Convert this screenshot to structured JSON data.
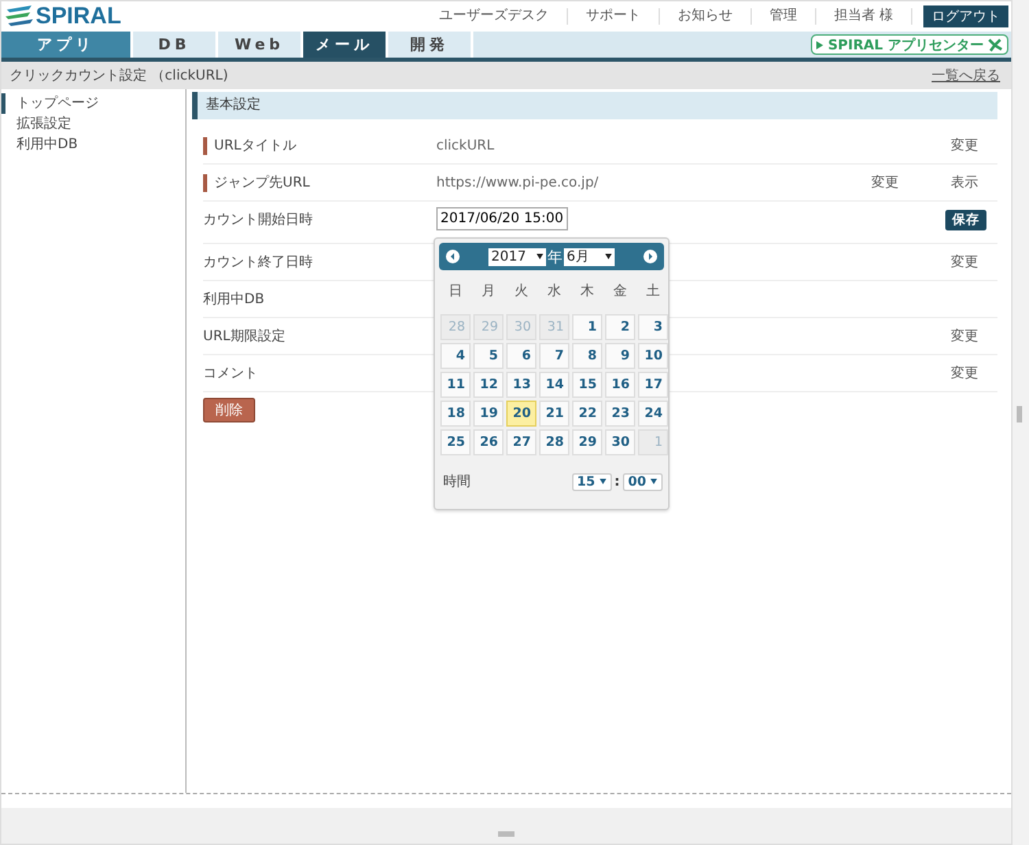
{
  "header": {
    "logo": "SPIRAL",
    "links": [
      "ユーザーズデスク",
      "サポート",
      "お知らせ",
      "管理",
      "担当者 様"
    ],
    "logout": "ログアウト"
  },
  "tabs": [
    {
      "label": "アプリ",
      "selected": false,
      "active": true
    },
    {
      "label": "DB",
      "selected": false,
      "active": false
    },
    {
      "label": "Web",
      "selected": false,
      "active": false
    },
    {
      "label": "メール",
      "selected": true,
      "active": false
    },
    {
      "label": "開発",
      "selected": false,
      "active": false
    }
  ],
  "app_center": "SPIRAL アプリセンター",
  "breadcrumb": {
    "title": "クリックカウント設定 （clickURL)",
    "back_link": "一覧へ戻る"
  },
  "sidebar": {
    "items": [
      {
        "label": "トップページ",
        "selected": true
      },
      {
        "label": "拡張設定",
        "selected": false
      },
      {
        "label": "利用中DB",
        "selected": false
      }
    ]
  },
  "section_title": "基本設定",
  "rows": [
    {
      "kind": "text",
      "label": "URLタイトル",
      "required": true,
      "value": "clickURL",
      "actions": [
        "変更"
      ]
    },
    {
      "kind": "text",
      "label": "ジャンプ先URL",
      "required": true,
      "value": "https://www.pi-pe.co.jp/",
      "actions": [
        "変更",
        "表示"
      ]
    },
    {
      "kind": "input",
      "label": "カウント開始日時",
      "required": false,
      "value": "2017/06/20 15:00",
      "actions": [
        "保存"
      ]
    },
    {
      "kind": "text",
      "label": "カウント終了日時",
      "required": false,
      "actions": [
        "変更"
      ]
    },
    {
      "kind": "text",
      "label": "利用中DB",
      "required": false
    },
    {
      "kind": "text",
      "label": "URL期限設定",
      "required": false,
      "actions": [
        "変更"
      ]
    },
    {
      "kind": "text",
      "label": "コメント",
      "required": false,
      "actions": [
        "変更"
      ]
    }
  ],
  "delete_button": "削除",
  "calendar": {
    "year": "2017",
    "year_suffix": "年",
    "month": "6月",
    "weekdays": [
      "日",
      "月",
      "火",
      "水",
      "木",
      "金",
      "土"
    ],
    "days": [
      {
        "day": "28",
        "outside": true,
        "selected": false
      },
      {
        "day": "29",
        "outside": true,
        "selected": false
      },
      {
        "day": "30",
        "outside": true,
        "selected": false
      },
      {
        "day": "31",
        "outside": true,
        "selected": false
      },
      {
        "day": "1",
        "outside": false,
        "selected": false
      },
      {
        "day": "2",
        "outside": false,
        "selected": false
      },
      {
        "day": "3",
        "outside": false,
        "selected": false
      },
      {
        "day": "4",
        "outside": false,
        "selected": false
      },
      {
        "day": "5",
        "outside": false,
        "selected": false
      },
      {
        "day": "6",
        "outside": false,
        "selected": false
      },
      {
        "day": "7",
        "outside": false,
        "selected": false
      },
      {
        "day": "8",
        "outside": false,
        "selected": false
      },
      {
        "day": "9",
        "outside": false,
        "selected": false
      },
      {
        "day": "10",
        "outside": false,
        "selected": false
      },
      {
        "day": "11",
        "outside": false,
        "selected": false
      },
      {
        "day": "12",
        "outside": false,
        "selected": false
      },
      {
        "day": "13",
        "outside": false,
        "selected": false
      },
      {
        "day": "14",
        "outside": false,
        "selected": false
      },
      {
        "day": "15",
        "outside": false,
        "selected": false
      },
      {
        "day": "16",
        "outside": false,
        "selected": false
      },
      {
        "day": "17",
        "outside": false,
        "selected": false
      },
      {
        "day": "18",
        "outside": false,
        "selected": false
      },
      {
        "day": "19",
        "outside": false,
        "selected": false
      },
      {
        "day": "20",
        "outside": false,
        "selected": true
      },
      {
        "day": "21",
        "outside": false,
        "selected": false
      },
      {
        "day": "22",
        "outside": false,
        "selected": false
      },
      {
        "day": "23",
        "outside": false,
        "selected": false
      },
      {
        "day": "24",
        "outside": false,
        "selected": false
      },
      {
        "day": "25",
        "outside": false,
        "selected": false
      },
      {
        "day": "26",
        "outside": false,
        "selected": false
      },
      {
        "day": "27",
        "outside": false,
        "selected": false
      },
      {
        "day": "28",
        "outside": false,
        "selected": false
      },
      {
        "day": "29",
        "outside": false,
        "selected": false
      },
      {
        "day": "30",
        "outside": false,
        "selected": false
      },
      {
        "day": "1",
        "outside": true,
        "selected": false
      }
    ],
    "time_label": "時間",
    "hour": "15",
    "minute_sep": ":",
    "minute": "00"
  }
}
